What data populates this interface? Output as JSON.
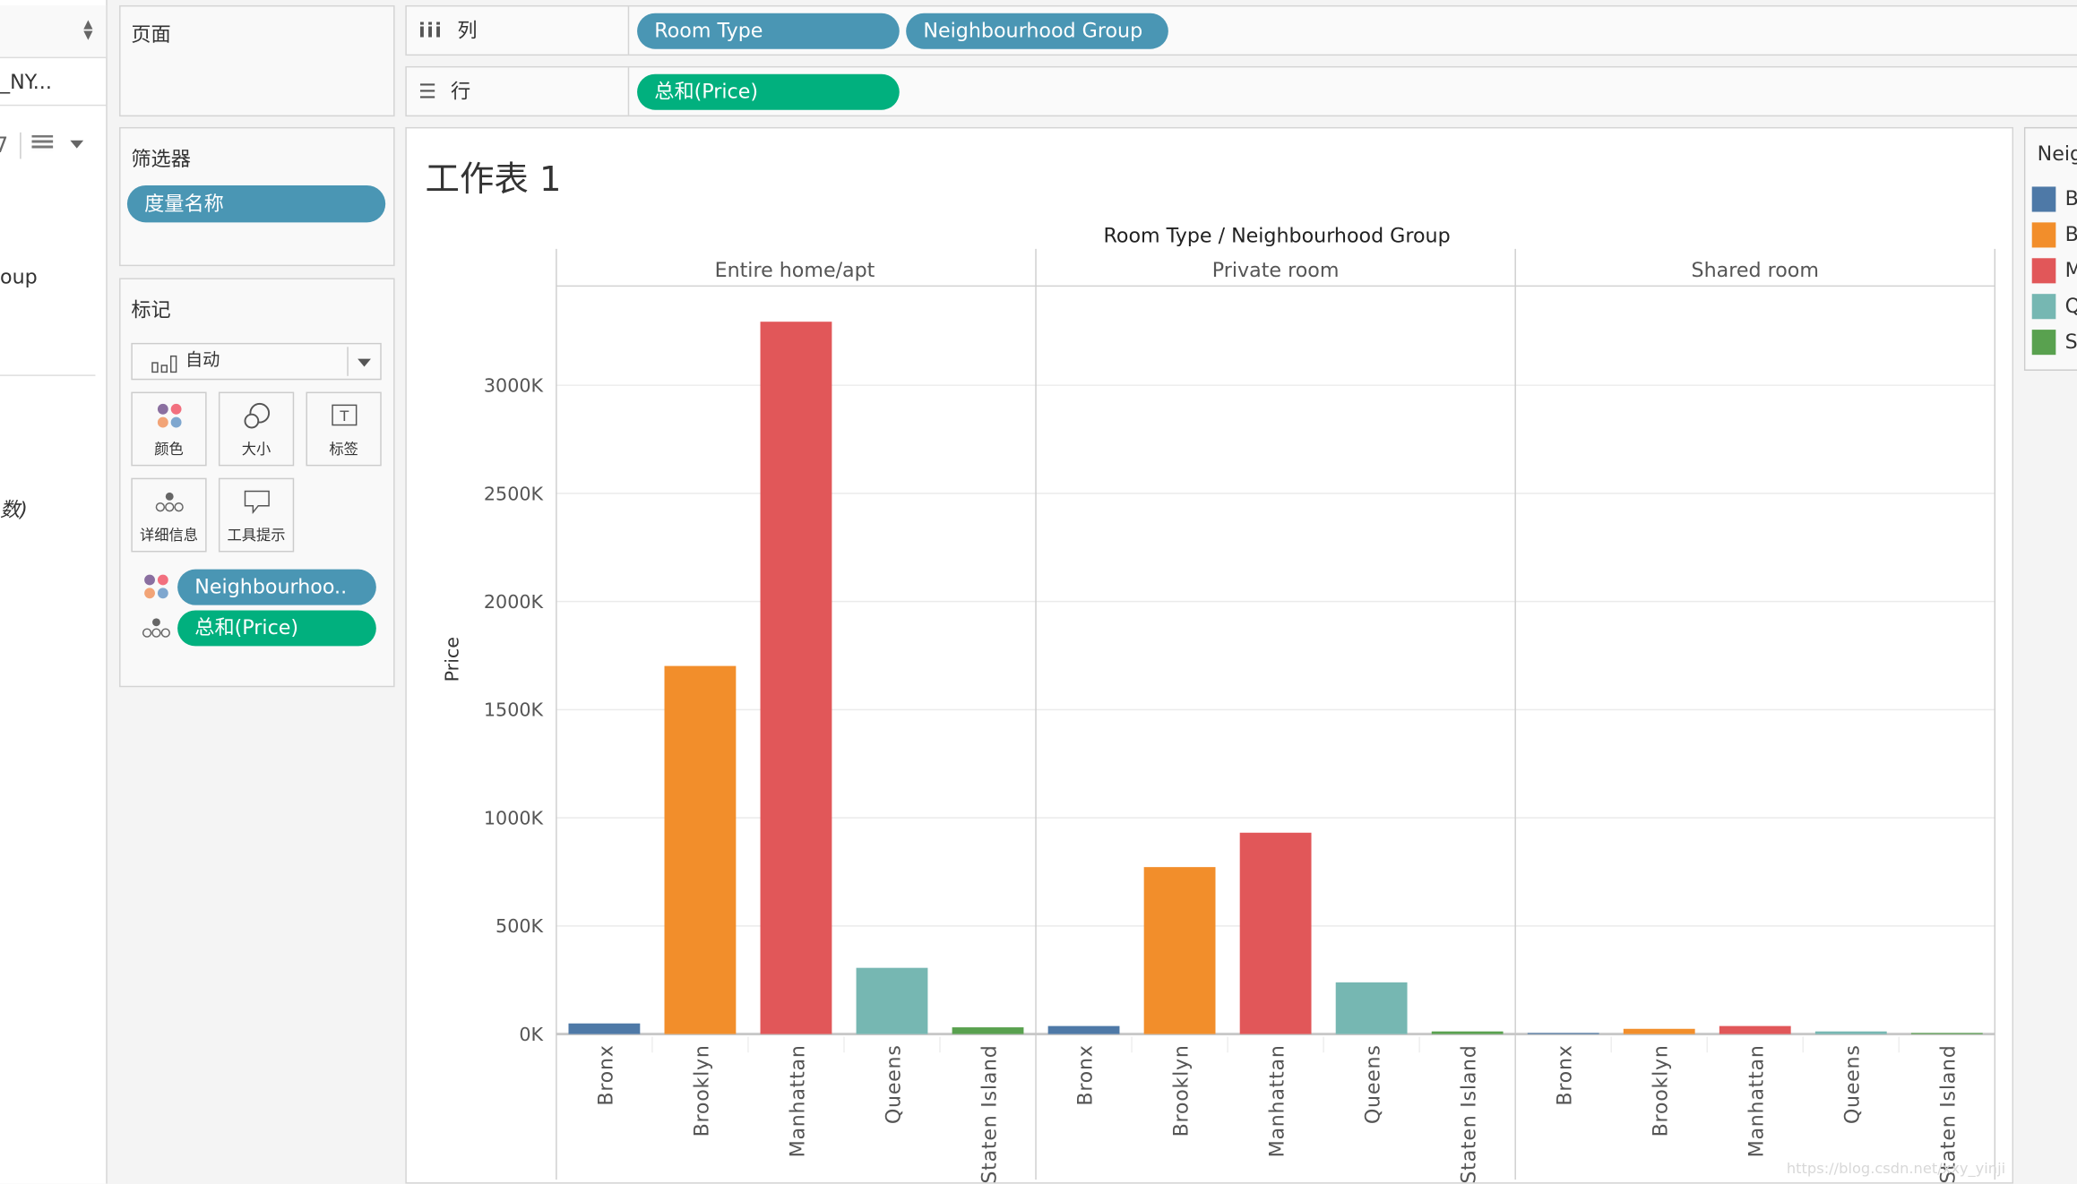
{
  "data_panel": {
    "datasource": "_NY...",
    "field_partial": "oup",
    "measure_partial": "数)"
  },
  "pages_card": {
    "title": "页面"
  },
  "filters_card": {
    "title": "筛选器",
    "pills": [
      {
        "label": "度量名称"
      }
    ]
  },
  "marks_card": {
    "title": "标记",
    "mark_type": "自动",
    "buttons": [
      {
        "label": "颜色",
        "icon": "color-icon"
      },
      {
        "label": "大小",
        "icon": "size-icon"
      },
      {
        "label": "标签",
        "icon": "label-icon"
      },
      {
        "label": "详细信息",
        "icon": "detail-icon"
      },
      {
        "label": "工具提示",
        "icon": "tooltip-icon"
      }
    ],
    "encodings": [
      {
        "type": "color",
        "label": "Neighbourhoo.."
      },
      {
        "type": "detail",
        "label": "总和(Price)"
      }
    ]
  },
  "shelves": {
    "columns": {
      "label": "列",
      "pills": [
        "Room Type",
        "Neighbourhood Group"
      ]
    },
    "rows": {
      "label": "行",
      "pills": [
        "总和(Price)"
      ]
    }
  },
  "sheet": {
    "title": "工作表 1"
  },
  "legend": {
    "title": "Neig",
    "items": [
      {
        "label": "B",
        "color": "#4e79a7"
      },
      {
        "label": "B",
        "color": "#f28e2b"
      },
      {
        "label": "M",
        "color": "#e15759"
      },
      {
        "label": "Q",
        "color": "#76b7b2"
      },
      {
        "label": "S",
        "color": "#59a14f"
      }
    ]
  },
  "watermark": "https://blog.csdn.net/xxy_yinji",
  "chart_data": {
    "type": "bar",
    "title": "Room Type / Neighbourhood Group",
    "xlabel": "",
    "ylabel": "Price",
    "ylim": [
      0,
      3450
    ],
    "y_unit": "K",
    "yticks": [
      0,
      500,
      1000,
      1500,
      2000,
      2500,
      3000
    ],
    "ytick_labels": [
      "0K",
      "500K",
      "1000K",
      "1500K",
      "2000K",
      "2500K",
      "3000K"
    ],
    "grid": true,
    "legend_position": "right",
    "panels": [
      "Entire home/apt",
      "Private room",
      "Shared room"
    ],
    "categories": [
      "Bronx",
      "Brooklyn",
      "Manhattan",
      "Queens",
      "Staten Island"
    ],
    "colors": [
      "#4e79a7",
      "#f28e2b",
      "#e15759",
      "#76b7b2",
      "#59a14f"
    ],
    "series": [
      {
        "name": "Entire home/apt",
        "values": [
          49,
          1702,
          3294,
          306,
          31
        ]
      },
      {
        "name": "Private room",
        "values": [
          37,
          772,
          931,
          239,
          12
        ]
      },
      {
        "name": "Shared room",
        "values": [
          2,
          24,
          37,
          12,
          1
        ]
      }
    ]
  }
}
